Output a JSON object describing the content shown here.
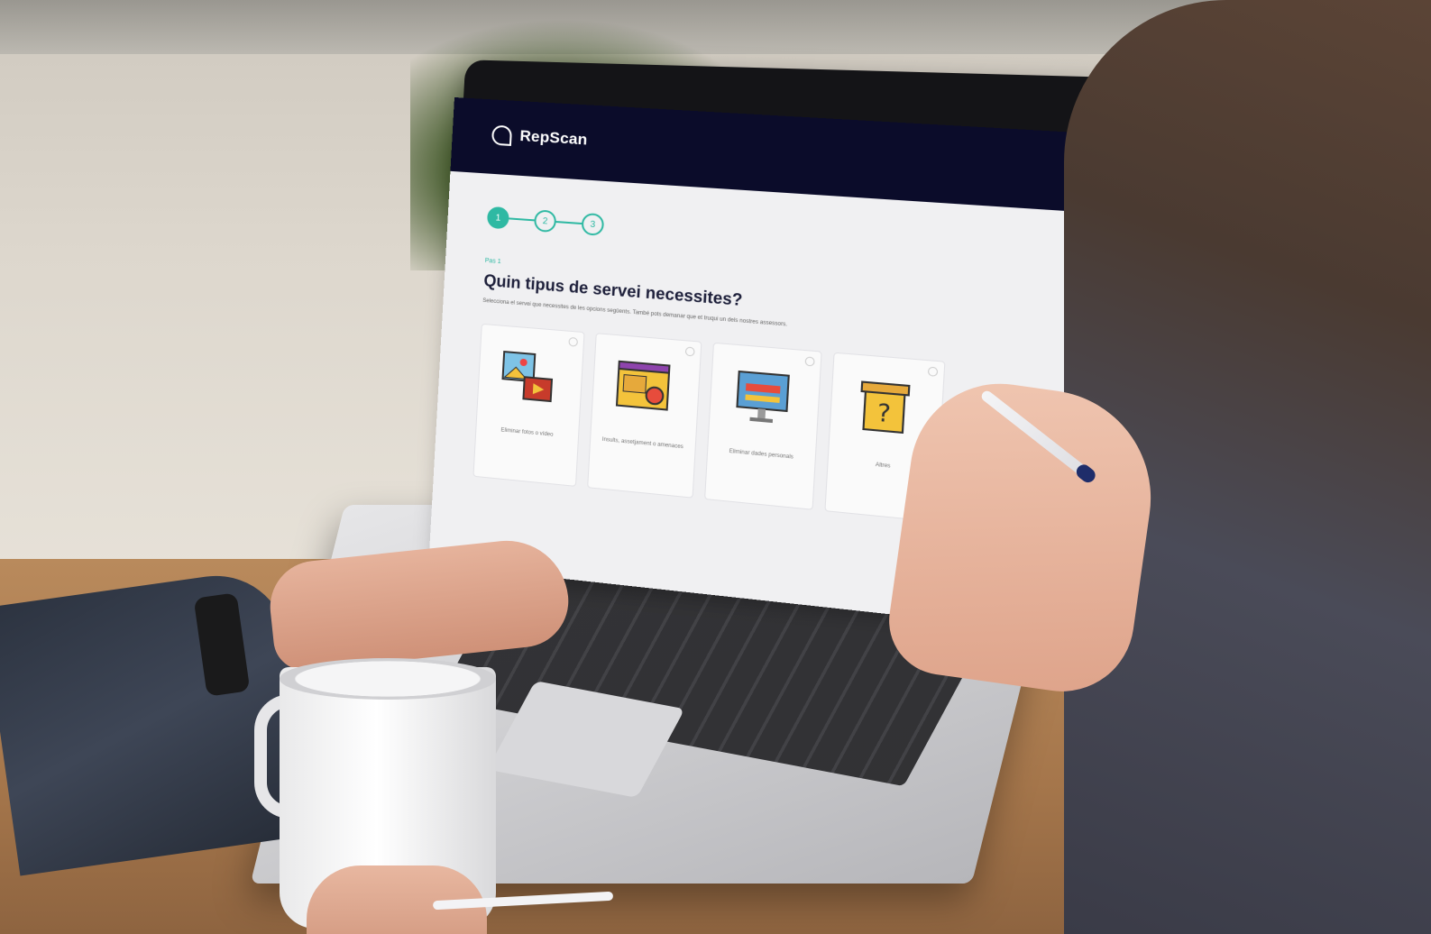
{
  "app": {
    "logo_text": "RepScan"
  },
  "wizard": {
    "steps": [
      "1",
      "2",
      "3"
    ],
    "active_step": 1,
    "step_label": "Pas 1",
    "question": "Quin tipus de servei necessites?",
    "subtitle": "Selecciona el servei que necessites de les opcions següents. També pots demanar que et truqui un dels nostres assessors."
  },
  "cards": [
    {
      "label": "Eliminar fotos o vídeo",
      "icon": "image-video-icon"
    },
    {
      "label": "Insults, assetjament o amenaces",
      "icon": "browser-threat-icon"
    },
    {
      "label": "Eliminar dades personals",
      "icon": "monitor-data-icon"
    },
    {
      "label": "Altres",
      "icon": "question-box-icon"
    }
  ],
  "colors": {
    "header_bg": "#0b0c2a",
    "accent": "#2fb9a3"
  }
}
